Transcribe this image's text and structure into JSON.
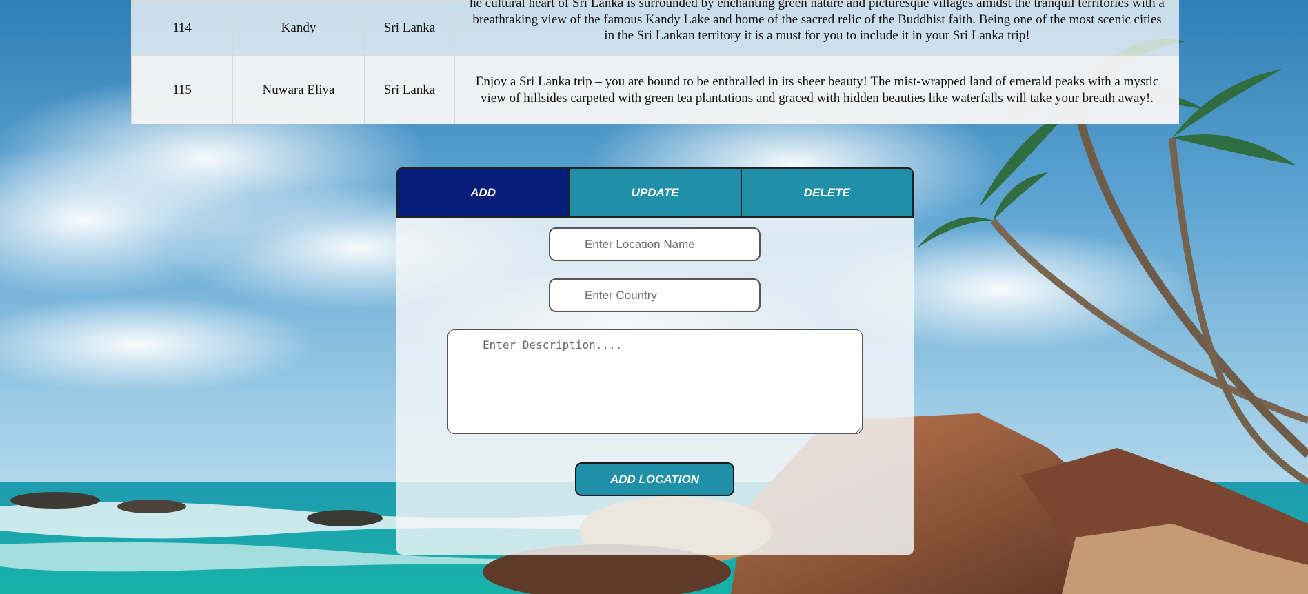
{
  "table": {
    "rows": [
      {
        "id": "114",
        "name": "Kandy",
        "country": "Sri Lanka",
        "description": "he cultural heart of Sri Lanka is surrounded by enchanting green nature and picturesque villages amidst the tranquil territories with a breathtaking view of the famous Kandy Lake and home of the sacred relic of the Buddhist faith. Being one of the most scenic cities in the Sri Lankan territory it is a must for you to include it in your Sri Lanka trip!"
      },
      {
        "id": "115",
        "name": "Nuwara Eliya",
        "country": "Sri Lanka",
        "description": "Enjoy a Sri Lanka trip – you are bound to be enthralled in its sheer beauty! The mist-wrapped land of emerald peaks with a mystic view of hillsides carpeted with green tea plantations and graced with hidden beauties like waterfalls will take your breath away!."
      }
    ]
  },
  "tabs": {
    "add": "ADD",
    "update": "UPDATE",
    "delete": "DELETE",
    "active": "ADD"
  },
  "form": {
    "name_placeholder": "Enter Location Name",
    "name_value": "",
    "country_placeholder": "Enter Country",
    "country_value": "",
    "description_placeholder": "Enter Description....",
    "description_value": "",
    "submit_label": "ADD LOCATION"
  },
  "colors": {
    "tab_active": "#031d78",
    "tab_inactive": "#208fa8",
    "button": "#208fa8"
  }
}
